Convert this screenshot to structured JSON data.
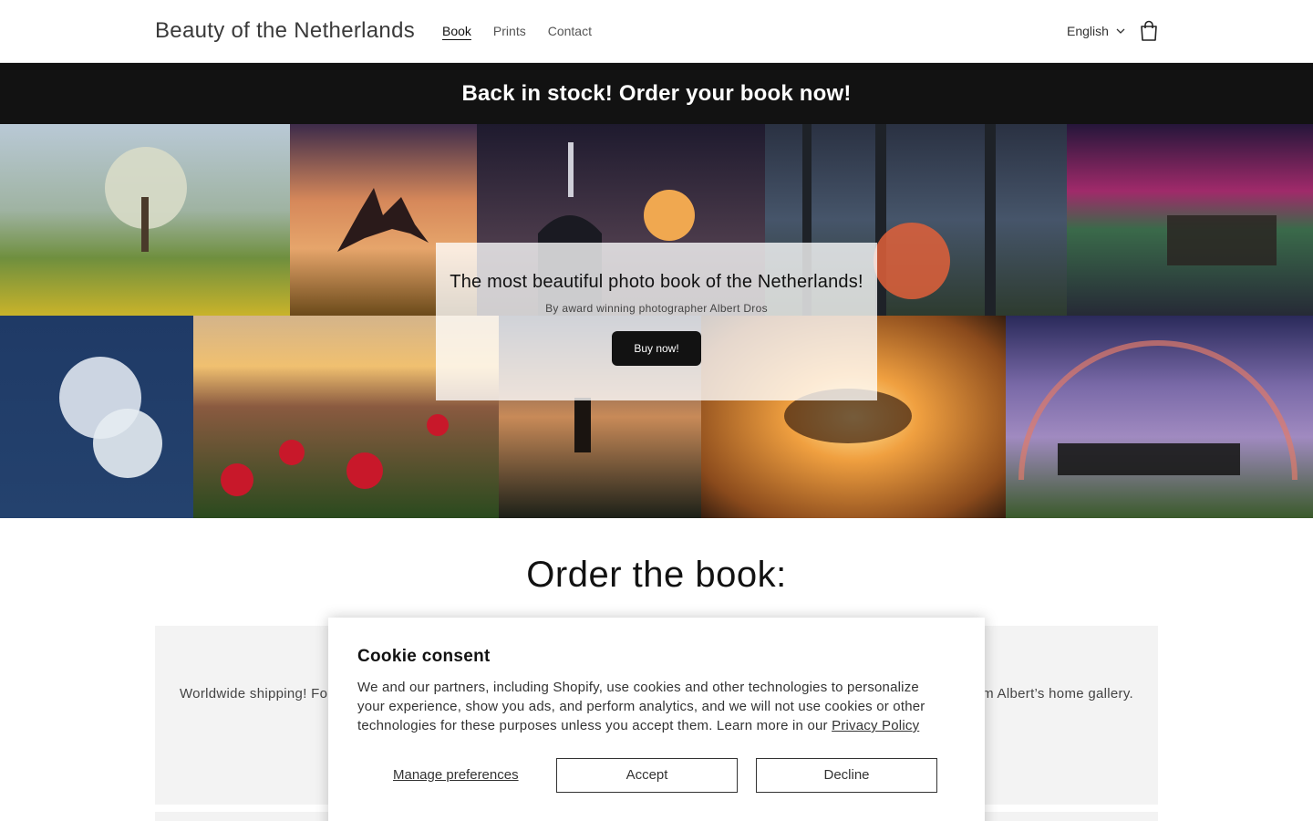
{
  "header": {
    "site_title": "Beauty of the Netherlands",
    "nav": [
      {
        "label": "Book",
        "active": true
      },
      {
        "label": "Prints",
        "active": false
      },
      {
        "label": "Contact",
        "active": false
      }
    ],
    "language": "English",
    "cart_icon": "cart-icon"
  },
  "announcement": {
    "text": "Back in stock! Order your book now!"
  },
  "hero": {
    "title": "The most beautiful photo book of the Netherlands!",
    "subtitle": "By award winning photographer Albert Dros",
    "button_label": "Buy now!",
    "photos": [
      "spring-tree-landscape",
      "horses-at-sunrise",
      "church-with-moon",
      "misty-forest-autumn",
      "aurora-over-pier",
      "frozen-blossom",
      "tulip-field",
      "windmill-at-dusk",
      "tree-at-sunrise",
      "rainbow-with-cows"
    ]
  },
  "order": {
    "heading": "Order the book:",
    "card_left_text": "Worldwide shipping! For",
    "card_right_text": "om Albert’s home gallery."
  },
  "cookie": {
    "title": "Cookie consent",
    "body": "We and our partners, including Shopify, use cookies and other technologies to personalize your experience, show you ads, and perform analytics, and we will not use cookies or other technologies for these purposes unless you accept them. Learn more in our",
    "privacy_link": "Privacy Policy",
    "manage_label": "Manage preferences",
    "accept_label": "Accept",
    "decline_label": "Decline"
  },
  "colors": {
    "announcement_bg": "#121212",
    "button_bg": "#121212",
    "card_bg": "#f3f3f3"
  }
}
